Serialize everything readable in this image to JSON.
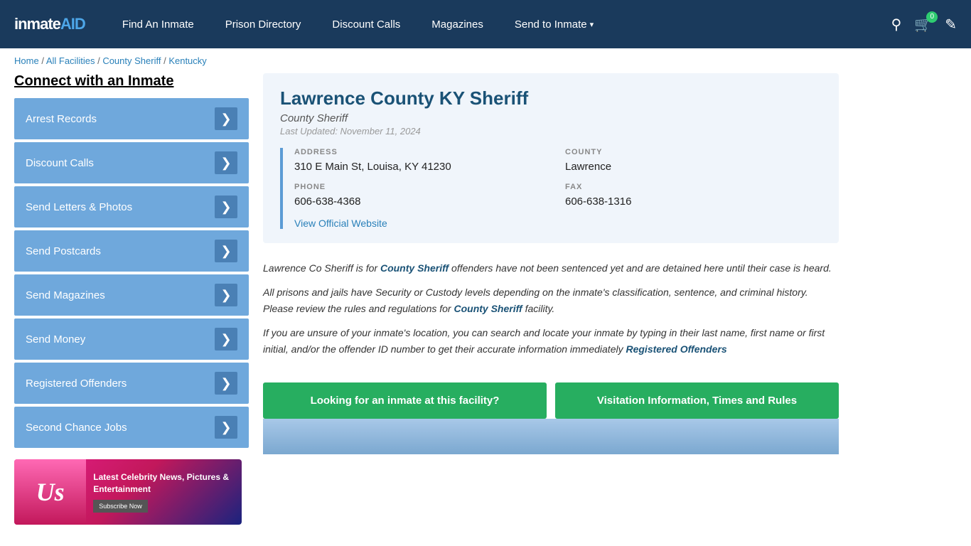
{
  "header": {
    "logo": "inmateAID",
    "nav": [
      {
        "label": "Find An Inmate",
        "id": "find-inmate",
        "dropdown": false
      },
      {
        "label": "Prison Directory",
        "id": "prison-directory",
        "dropdown": false
      },
      {
        "label": "Discount Calls",
        "id": "discount-calls",
        "dropdown": false
      },
      {
        "label": "Magazines",
        "id": "magazines",
        "dropdown": false
      },
      {
        "label": "Send to Inmate",
        "id": "send-to-inmate",
        "dropdown": true
      }
    ],
    "cart_count": "0"
  },
  "breadcrumb": {
    "items": [
      "Home",
      "All Facilities",
      "County Sheriff",
      "Kentucky"
    ]
  },
  "sidebar": {
    "title": "Connect with an Inmate",
    "items": [
      {
        "label": "Arrest Records",
        "id": "arrest-records"
      },
      {
        "label": "Discount Calls",
        "id": "discount-calls"
      },
      {
        "label": "Send Letters & Photos",
        "id": "send-letters"
      },
      {
        "label": "Send Postcards",
        "id": "send-postcards"
      },
      {
        "label": "Send Magazines",
        "id": "send-magazines"
      },
      {
        "label": "Send Money",
        "id": "send-money"
      },
      {
        "label": "Registered Offenders",
        "id": "registered-offenders"
      },
      {
        "label": "Second Chance Jobs",
        "id": "second-chance-jobs"
      }
    ],
    "ad": {
      "brand": "Us",
      "headline": "Latest Celebrity News, Pictures & Entertainment",
      "subscribe": "Subscribe Now"
    }
  },
  "facility": {
    "name": "Lawrence County KY Sheriff",
    "type": "County Sheriff",
    "updated": "Last Updated: November 11, 2024",
    "address_label": "ADDRESS",
    "address": "310 E Main St, Louisa, KY 41230",
    "county_label": "COUNTY",
    "county": "Lawrence",
    "phone_label": "PHONE",
    "phone": "606-638-4368",
    "fax_label": "FAX",
    "fax": "606-638-1316",
    "website_link": "View Official Website"
  },
  "description": {
    "para1": "Lawrence Co Sheriff is for County Sheriff offenders have not been sentenced yet and are detained here until their case is heard.",
    "para2": "All prisons and jails have Security or Custody levels depending on the inmate's classification, sentence, and criminal history. Please review the rules and regulations for County Sheriff facility.",
    "para3": "If you are unsure of your inmate's location, you can search and locate your inmate by typing in their last name, first name or first initial, and/or the offender ID number to get their accurate information immediately Registered Offenders",
    "county_sheriff_link": "County Sheriff",
    "registered_offenders_link": "Registered Offenders"
  },
  "buttons": {
    "find_inmate": "Looking for an inmate at this facility?",
    "visitation": "Visitation Information, Times and Rules"
  }
}
